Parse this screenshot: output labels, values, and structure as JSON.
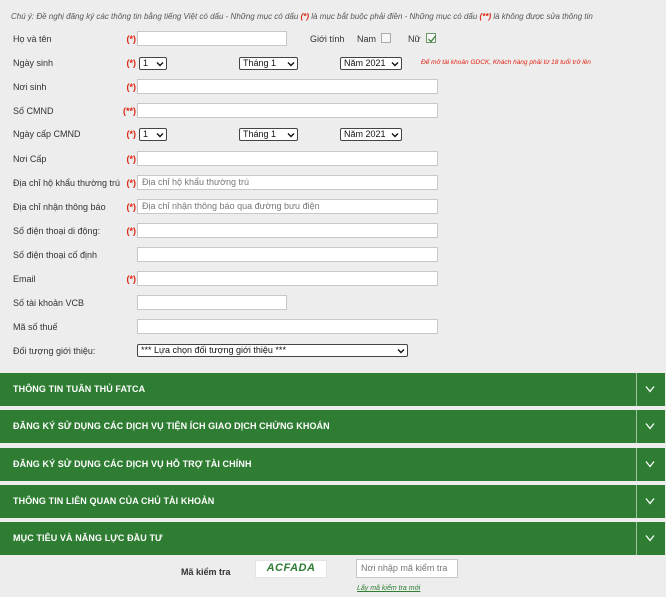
{
  "note": {
    "prefix": "Chú ý: Đề nghị đăng ký các thông tin bằng tiếng Việt có dấu - Những mục có dấu",
    "req1": "(*)",
    "mid": "là mục bắt buộc phải điền - Những mục có dấu",
    "req2": "(**)",
    "suffix": "là không được sửa thông tin"
  },
  "form": {
    "full_name": {
      "label": "Họ và tên",
      "mark": "(*)",
      "value": ""
    },
    "gender": {
      "label": "Giới tính",
      "male": "Nam",
      "female": "Nữ",
      "selected": "female"
    },
    "birth_date": {
      "label": "Ngày sinh",
      "mark": "(*)",
      "day": "1",
      "month": "Tháng 1",
      "year": "Năm 2021"
    },
    "age_note": "Để mở tài khoản GDCK, Khách hàng phải từ 18 tuổi trở lên",
    "birth_place": {
      "label": "Nơi sinh",
      "mark": "(*)",
      "value": ""
    },
    "id_number": {
      "label": "Số CMND",
      "mark": "(**)",
      "value": ""
    },
    "issue_date": {
      "label": "Ngày cấp CMND",
      "mark": "(*)",
      "day": "1",
      "month": "Tháng 1",
      "year": "Năm 2021"
    },
    "issue_place": {
      "label": "Nơi Cấp",
      "mark": "(*)",
      "value": ""
    },
    "permanent_address": {
      "label": "Địa chỉ hộ khẩu thường trú",
      "mark": "(*)",
      "placeholder": "Địa chỉ hộ khẩu thường trú"
    },
    "mailing_address": {
      "label": "Địa chỉ nhận thông báo",
      "mark": "(*)",
      "placeholder": "Địa chỉ nhận thông báo qua đường bưu điện"
    },
    "mobile": {
      "label": "Số điện thoại di động:",
      "mark": "(*)",
      "value": ""
    },
    "landline": {
      "label": "Số điện thoại cố định",
      "value": ""
    },
    "email": {
      "label": "Email",
      "mark": "(*)",
      "value": ""
    },
    "vcb_account": {
      "label": "Số tài khoản VCB",
      "value": ""
    },
    "tax_code": {
      "label": "Mã số thuế",
      "value": ""
    },
    "referral": {
      "label": "Đối tượng giới thiệu:",
      "selected": "*** Lựa chọn đối tượng giới thiệu ***"
    }
  },
  "sections": [
    {
      "title": "THÔNG TIN TUÂN THỦ FATCA"
    },
    {
      "title": "ĐĂNG KÝ SỬ DỤNG CÁC DỊCH VỤ TIỆN ÍCH GIAO DỊCH CHỨNG KHOÁN"
    },
    {
      "title": "ĐĂNG KÝ SỬ DỤNG CÁC DỊCH VỤ HỖ TRỢ TÀI CHÍNH"
    },
    {
      "title": "THÔNG TIN LIÊN QUAN CỦA CHỦ TÀI KHOẢN"
    },
    {
      "title": "MỤC TIÊU VÀ NĂNG LỰC ĐẦU TƯ"
    }
  ],
  "captcha": {
    "label": "Mã kiểm tra",
    "image_text": "ACFADA",
    "placeholder": "Nơi nhập mã kiểm tra",
    "refresh_link": "Lấy mã kiểm tra mới"
  },
  "colors": {
    "section_bg": "#2e7d32",
    "required": "#d21111",
    "page_bg": "#ededed"
  }
}
